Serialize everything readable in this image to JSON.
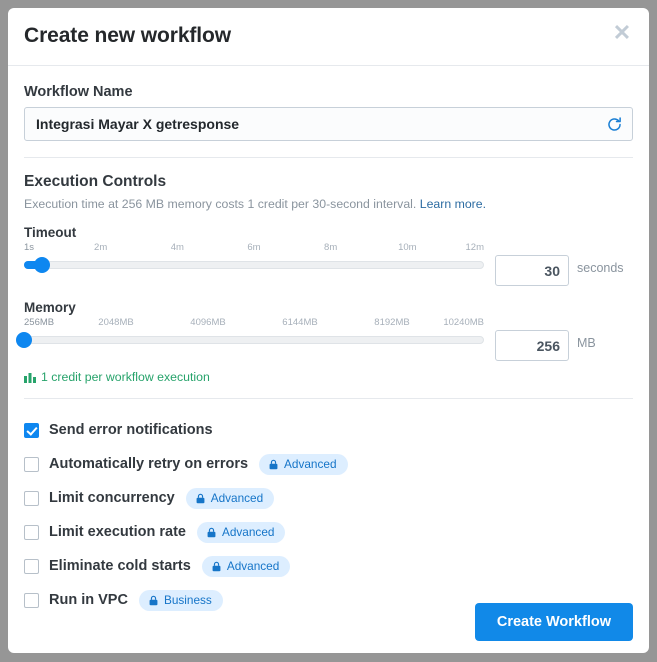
{
  "modal": {
    "title": "Create new workflow",
    "close_icon": "close-icon"
  },
  "workflow_name": {
    "label": "Workflow Name",
    "value": "Integrasi Mayar X getresponse",
    "placeholder": "Workflow Name",
    "refresh_icon": "refresh-icon"
  },
  "execution_controls": {
    "title": "Execution Controls",
    "description": "Execution time at 256 MB memory costs 1 credit per 30-second interval.",
    "link_label": "Learn more.",
    "timeout": {
      "label": "Timeout",
      "ticks": [
        "1s",
        "2m",
        "4m",
        "6m",
        "8m",
        "10m",
        "12m"
      ],
      "value": "30",
      "unit": "seconds",
      "thumb_percent": 4
    },
    "memory": {
      "label": "Memory",
      "ticks": [
        "256MB",
        "2048MB",
        "4096MB",
        "6144MB",
        "8192MB",
        "10240MB"
      ],
      "value": "256",
      "unit": "MB",
      "thumb_percent": 0
    },
    "credit_note": "1 credit per workflow execution",
    "credit_icon": "bar-chart-icon",
    "credit_color": "#27a36b"
  },
  "options": [
    {
      "label": "Send error notifications",
      "checked": true,
      "badge": null
    },
    {
      "label": "Automatically retry on errors",
      "checked": false,
      "badge": "Advanced"
    },
    {
      "label": "Limit concurrency",
      "checked": false,
      "badge": "Advanced"
    },
    {
      "label": "Limit execution rate",
      "checked": false,
      "badge": "Advanced"
    },
    {
      "label": "Eliminate cold starts",
      "checked": false,
      "badge": "Advanced"
    },
    {
      "label": "Run in VPC",
      "checked": false,
      "badge": "Business"
    }
  ],
  "footer": {
    "create_label": "Create Workflow"
  },
  "colors": {
    "accent": "#0e87f0",
    "primary_button": "#1189e8",
    "badge_bg": "#ddeeff",
    "badge_text": "#1675c8"
  }
}
